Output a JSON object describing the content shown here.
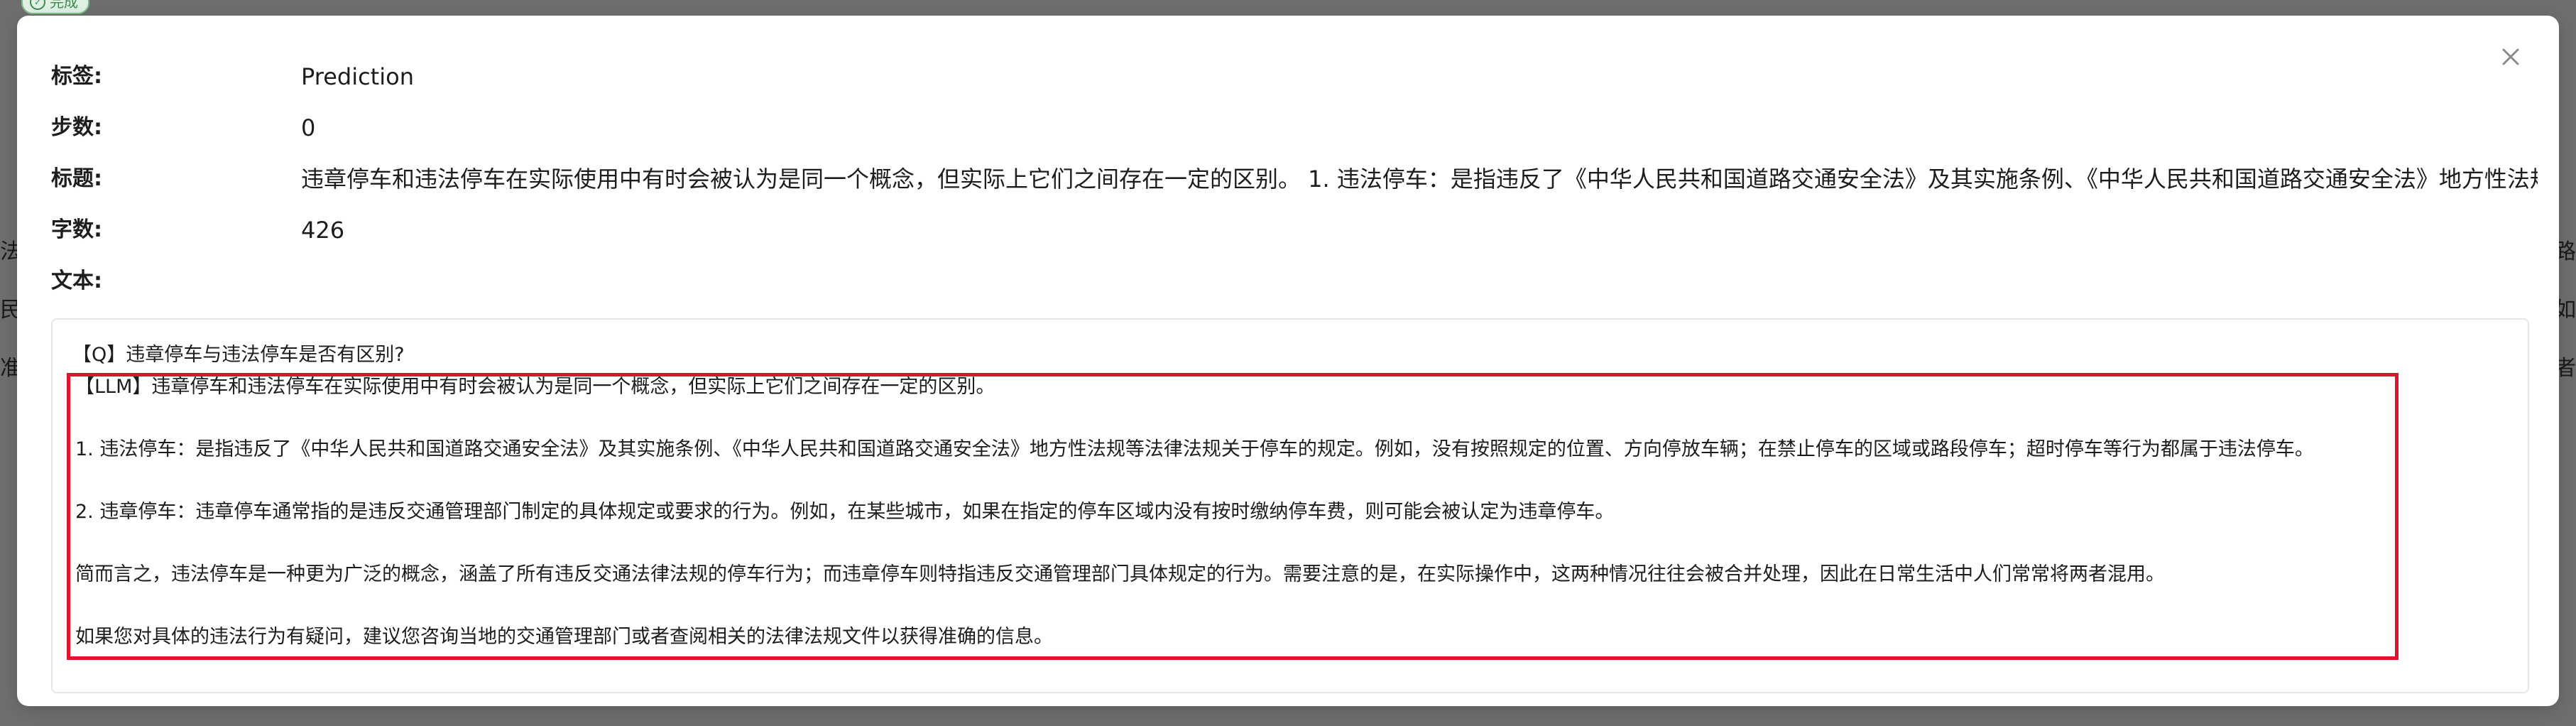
{
  "background": {
    "status_label": "完成",
    "left_fragments": [
      "法",
      "民",
      "准"
    ],
    "right_fragments": [
      "路",
      "如",
      "者"
    ]
  },
  "modal": {
    "close_icon": "close-icon",
    "fields": {
      "tag_label": "标签:",
      "tag_value": "Prediction",
      "step_label": "步数:",
      "step_value": "0",
      "title_label": "标题:",
      "title_value": "违章停车和违法停车在实际使用中有时会被认为是同一个概念，但实际上它们之间存在一定的区别。 1. 违法停车：是指违反了《中华人民共和国道路交通安全法》及其实施条例、《中华人民共和国道路交通安全法》地方性法规",
      "count_label": "字数:",
      "count_value": "426",
      "text_label": "文本:"
    },
    "content": {
      "question": "【Q】违章停车与违法停车是否有区别?",
      "lines": [
        "【LLM】违章停车和违法停车在实际使用中有时会被认为是同一个概念，但实际上它们之间存在一定的区别。",
        "1. 违法停车：是指违反了《中华人民共和国道路交通安全法》及其实施条例、《中华人民共和国道路交通安全法》地方性法规等法律法规关于停车的规定。例如，没有按照规定的位置、方向停放车辆；在禁止停车的区域或路段停车；超时停车等行为都属于违法停车。",
        "2. 违章停车：违章停车通常指的是违反交通管理部门制定的具体规定或要求的行为。例如，在某些城市，如果在指定的停车区域内没有按时缴纳停车费，则可能会被认定为违章停车。",
        "简而言之，违法停车是一种更为广泛的概念，涵盖了所有违反交通法律法规的停车行为；而违章停车则特指违反交通管理部门具体规定的行为。需要注意的是，在实际操作中，这两种情况往往会被合并处理，因此在日常生活中人们常常将两者混用。",
        "如果您对具体的违法行为有疑问，建议您咨询当地的交通管理部门或者查阅相关的法律法规文件以获得准确的信息。"
      ]
    },
    "highlight_color": "#e0142c"
  }
}
